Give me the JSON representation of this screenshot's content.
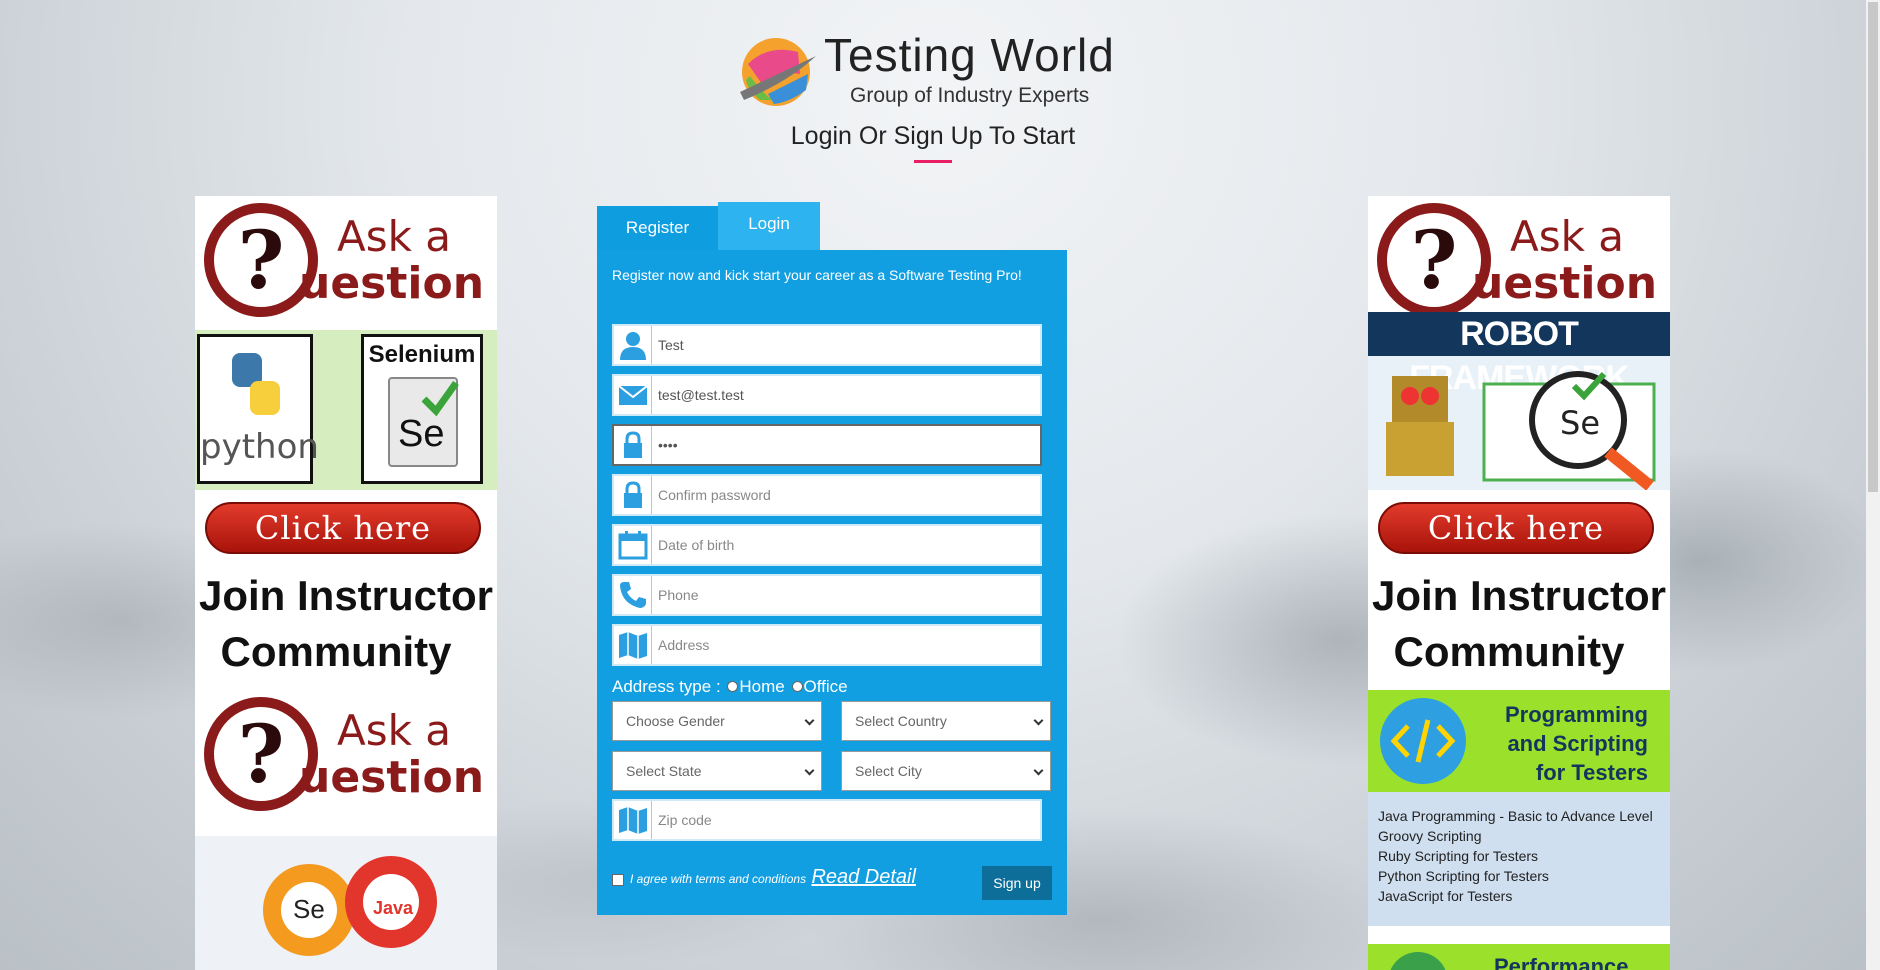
{
  "header": {
    "brand": "Testing World",
    "tagline": "Group of Industry Experts",
    "page_title": "Login Or Sign Up To Start",
    "accent_color": "#e91e63"
  },
  "tabs": [
    {
      "label": "Register",
      "active": true
    },
    {
      "label": "Login",
      "active": false
    }
  ],
  "form": {
    "intro": "Register now and kick start your career as a Software Testing Pro!",
    "fields": {
      "name": {
        "value": "Test",
        "icon": "user-icon"
      },
      "email": {
        "value": "test@test.test",
        "icon": "envelope-icon"
      },
      "password": {
        "value": "••••",
        "icon": "lock-icon"
      },
      "confirm_password": {
        "placeholder": "Confirm password",
        "icon": "lock-icon"
      },
      "dob": {
        "placeholder": "Date of birth",
        "icon": "calendar-icon"
      },
      "phone": {
        "placeholder": "Phone",
        "icon": "phone-icon"
      },
      "address": {
        "placeholder": "Address",
        "icon": "map-icon"
      },
      "zip": {
        "placeholder": "Zip code",
        "icon": "map-icon"
      }
    },
    "address_type": {
      "label": "Address type :",
      "options": [
        "Home",
        "Office"
      ]
    },
    "selects": {
      "gender": "Choose Gender",
      "country": "Select Country",
      "state": "Select State",
      "city": "Select City"
    },
    "terms_text": "I agree with terms and conditions",
    "read_detail": "Read Detail",
    "signup_label": "Sign up",
    "panel_color": "#119fe1"
  },
  "ads": {
    "ask_line1": "Ask a",
    "ask_line2": "uestion",
    "python_label": "python",
    "selenium_label": "Selenium",
    "se_label": "Se",
    "java_label": "Java",
    "click_here": "Click here",
    "join_line1": "Join Instructor",
    "join_line2": "Community",
    "robot_label": "ROBOT FRAMEWORK",
    "programming_title": [
      "Programming",
      "and Scripting",
      "for Testers"
    ],
    "courses": [
      "Java Programming - Basic to Advance Level",
      "Groovy Scripting",
      "Ruby Scripting for Testers",
      "Python Scripting for Testers",
      "JavaScript for Testers"
    ],
    "performance_partial": "Performance"
  }
}
